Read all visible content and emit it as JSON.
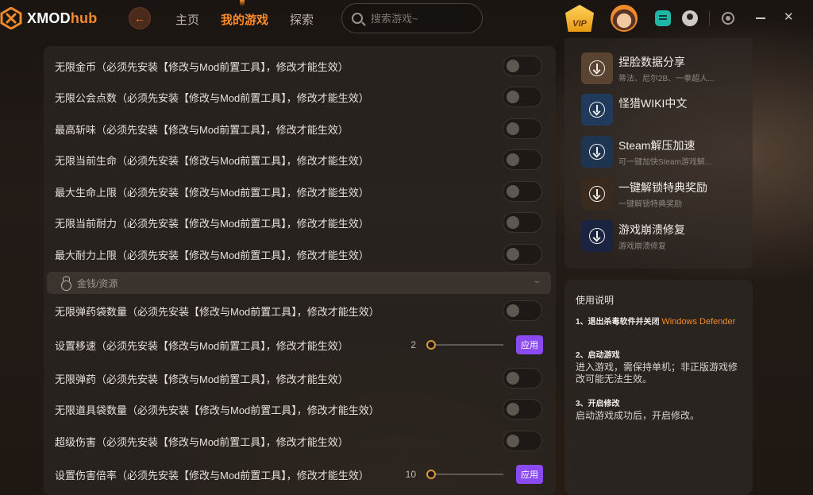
{
  "header": {
    "brand_main": "XMOD",
    "brand_accent": "hub",
    "nav": [
      {
        "label": "主页",
        "active": false
      },
      {
        "label": "我的游戏",
        "active": true
      },
      {
        "label": "探索",
        "active": false
      }
    ],
    "search_placeholder": "搜索游戏~",
    "vip_label": "VIP",
    "accent_color": "#f08a2a"
  },
  "mods": {
    "rows": [
      {
        "label": "无限金币（必须先安装【修改与Mod前置工具】，修改才能生效）",
        "type": "toggle",
        "on": false
      },
      {
        "label": "无限公会点数（必须先安装【修改与Mod前置工具】，修改才能生效）",
        "type": "toggle",
        "on": false
      },
      {
        "label": "最高斩味（必须先安装【修改与Mod前置工具】，修改才能生效）",
        "type": "toggle",
        "on": false
      },
      {
        "label": "无限当前生命（必须先安装【修改与Mod前置工具】，修改才能生效）",
        "type": "toggle",
        "on": false
      },
      {
        "label": "最大生命上限（必须先安装【修改与Mod前置工具】，修改才能生效）",
        "type": "toggle",
        "on": false
      },
      {
        "label": "无限当前耐力（必须先安装【修改与Mod前置工具】，修改才能生效）",
        "type": "toggle",
        "on": false
      },
      {
        "label": "最大耐力上限（必须先安装【修改与Mod前置工具】，修改才能生效）",
        "type": "toggle",
        "on": false
      }
    ],
    "section_label": "金钱/资源",
    "rows2": [
      {
        "label": "无限弹药袋数量（必须先安装【修改与Mod前置工具】，修改才能生效）",
        "type": "toggle",
        "on": false
      },
      {
        "label": "设置移速（必须先安装【修改与Mod前置工具】，修改才能生效）",
        "type": "slider",
        "value": "2",
        "apply": "应用"
      },
      {
        "label": "无限弹药（必须先安装【修改与Mod前置工具】，修改才能生效）",
        "type": "toggle",
        "on": false
      },
      {
        "label": "无限道具袋数量（必须先安装【修改与Mod前置工具】，修改才能生效）",
        "type": "toggle",
        "on": false
      },
      {
        "label": "超级伤害（必须先安装【修改与Mod前置工具】，修改才能生效）",
        "type": "toggle",
        "on": false
      },
      {
        "label": "设置伤害倍率（必须先安装【修改与Mod前置工具】，修改才能生效）",
        "type": "slider",
        "value": "10",
        "apply": "应用"
      }
    ]
  },
  "tools": [
    {
      "title": "捏脸数据分享",
      "subtitle": "蒂法、尼尔2B、一拳超人...",
      "icon": "download-icon",
      "tile_color": "#5a4330"
    },
    {
      "title": "怪猎WIKI中文",
      "subtitle": "",
      "icon": "download-icon",
      "tile_color": "#1f3a5a"
    },
    {
      "title": "Steam解压加速",
      "subtitle": "可一键加快Steam游戏解...",
      "icon": "download-icon",
      "tile_color": "#1e3552"
    },
    {
      "title": "一键解锁特典奖励",
      "subtitle": "一键解锁特典奖励",
      "icon": "download-icon",
      "tile_color": "#3a2a1e"
    },
    {
      "title": "游戏崩溃修复",
      "subtitle": "游戏崩溃修复",
      "icon": "download-icon",
      "tile_color": "#1a2440"
    }
  ],
  "instructions": {
    "title": "使用说明",
    "step1_head": "1、退出杀毒软件并关闭 ",
    "step1_highlight": "Windows Defender",
    "step2_head": "2、启动游戏",
    "step2_body": "进入游戏，需保持单机；非正版游戏修改可能无法生效。",
    "step3_head": "3、开启修改",
    "step3_body": "启动游戏成功后，开启修改。"
  },
  "colors": {
    "toggle_off": "#5e5852",
    "apply_button": "#8a4af0",
    "highlight": "#f08a2a"
  }
}
